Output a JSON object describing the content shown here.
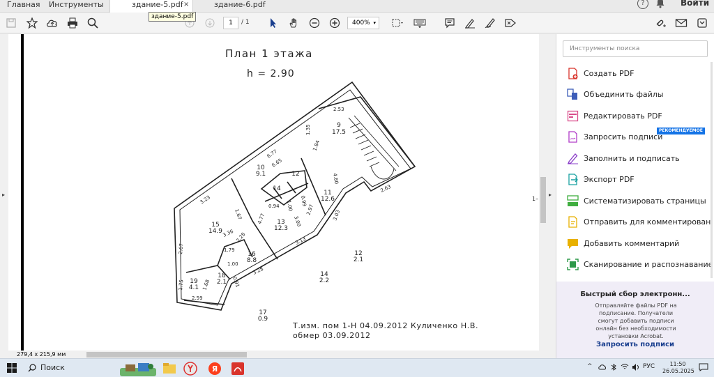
{
  "nav_tabs": [
    "Главная",
    "Инструменты"
  ],
  "doc_tabs": [
    {
      "label": "здание-5.pdf",
      "active": true
    },
    {
      "label": "здание-6.pdf",
      "active": false
    }
  ],
  "tab_close_glyph": "×",
  "tab_tooltip": "здание-5.pdf",
  "header_right": {
    "help_glyph": "?",
    "signin": "Войти"
  },
  "toolbar": {
    "page_current": "1",
    "page_total": "/ 1",
    "zoom": "400%",
    "zoom_caret": "▾"
  },
  "document": {
    "title": "План 1 этажа",
    "height_note": "h = 2.90",
    "note_line1": "Т.изм. пом 1-Н 04.09.2012 Куличенко Н.В.",
    "note_line2": "обмер 03.09.2012",
    "margin_marker": "1–",
    "rooms": [
      {
        "num": "9",
        "area": "17.5"
      },
      {
        "num": "10",
        "area": "9.1"
      },
      {
        "num": "11",
        "area": "12.6"
      },
      {
        "num": "12",
        "area": ""
      },
      {
        "num": "13",
        "area": "12.3"
      },
      {
        "num": "14",
        "area": ""
      },
      {
        "num": "15",
        "area": "14.9"
      },
      {
        "num": "16",
        "area": "8.8"
      },
      {
        "num": "18",
        "area": "2.1"
      },
      {
        "num": "19",
        "area": "4.1"
      }
    ],
    "outside_labels": [
      {
        "num": "12",
        "area": "2.1"
      },
      {
        "num": "14",
        "area": "2.2"
      },
      {
        "num": "17",
        "area": "0.9"
      }
    ],
    "dims": [
      "2.53",
      "1.35",
      "1.84",
      "6.77",
      "6.65",
      "4.80",
      "3.23",
      "2.63",
      "0.94",
      "1.00",
      "0.99",
      "2.97",
      "3.03",
      "1.67",
      "4.77",
      "3.00",
      "3.13",
      "3.36",
      "2.28",
      "2.67",
      "1.79",
      "1.00",
      "3.28",
      "1.75",
      "1.68",
      "2.59",
      "0.91"
    ]
  },
  "status_size": "279,4 x 215,9 мм",
  "right_pane": {
    "search_placeholder": "Инструменты поиска",
    "tools": [
      {
        "label": "Создать PDF",
        "icon": "create-pdf-icon",
        "color": "#d9342c"
      },
      {
        "label": "Объединить файлы",
        "icon": "combine-files-icon",
        "color": "#3d5db8"
      },
      {
        "label": "Редактировать PDF",
        "icon": "edit-pdf-icon",
        "color": "#d94f8c"
      },
      {
        "label": "Запросить подписи",
        "icon": "request-signatures-icon",
        "color": "#b13cc8",
        "badge": "РЕКОМЕНДУЕМОЕ"
      },
      {
        "label": "Заполнить и подписать",
        "icon": "fill-sign-icon",
        "color": "#8a3dc8"
      },
      {
        "label": "Экспорт PDF",
        "icon": "export-pdf-icon",
        "color": "#1aa2a2"
      },
      {
        "label": "Систематизировать страницы",
        "icon": "organize-pages-icon",
        "color": "#3fae3f"
      },
      {
        "label": "Отправить для комментирован...",
        "icon": "send-comment-icon",
        "color": "#e8b100"
      },
      {
        "label": "Добавить комментарий",
        "icon": "comment-icon",
        "color": "#e8b100"
      },
      {
        "label": "Сканирование и распознавание",
        "icon": "scan-ocr-icon",
        "color": "#2e9a4a"
      }
    ],
    "promo": {
      "title": "Быстрый сбор электронн...",
      "text": "Отправляйте файлы PDF на подписание. Получатели смогут добавить подписи онлайн без необходимости установки Acrobat.",
      "link": "Запросить подписи"
    }
  },
  "taskbar": {
    "search_label": "Поиск",
    "lang": "РУС",
    "time": "11:50",
    "date": "26.05.2025"
  },
  "colors": {
    "accent": "#1473e6",
    "promo_bg": "#f0edf7",
    "taskbar_bg": "#dfe8f2"
  }
}
